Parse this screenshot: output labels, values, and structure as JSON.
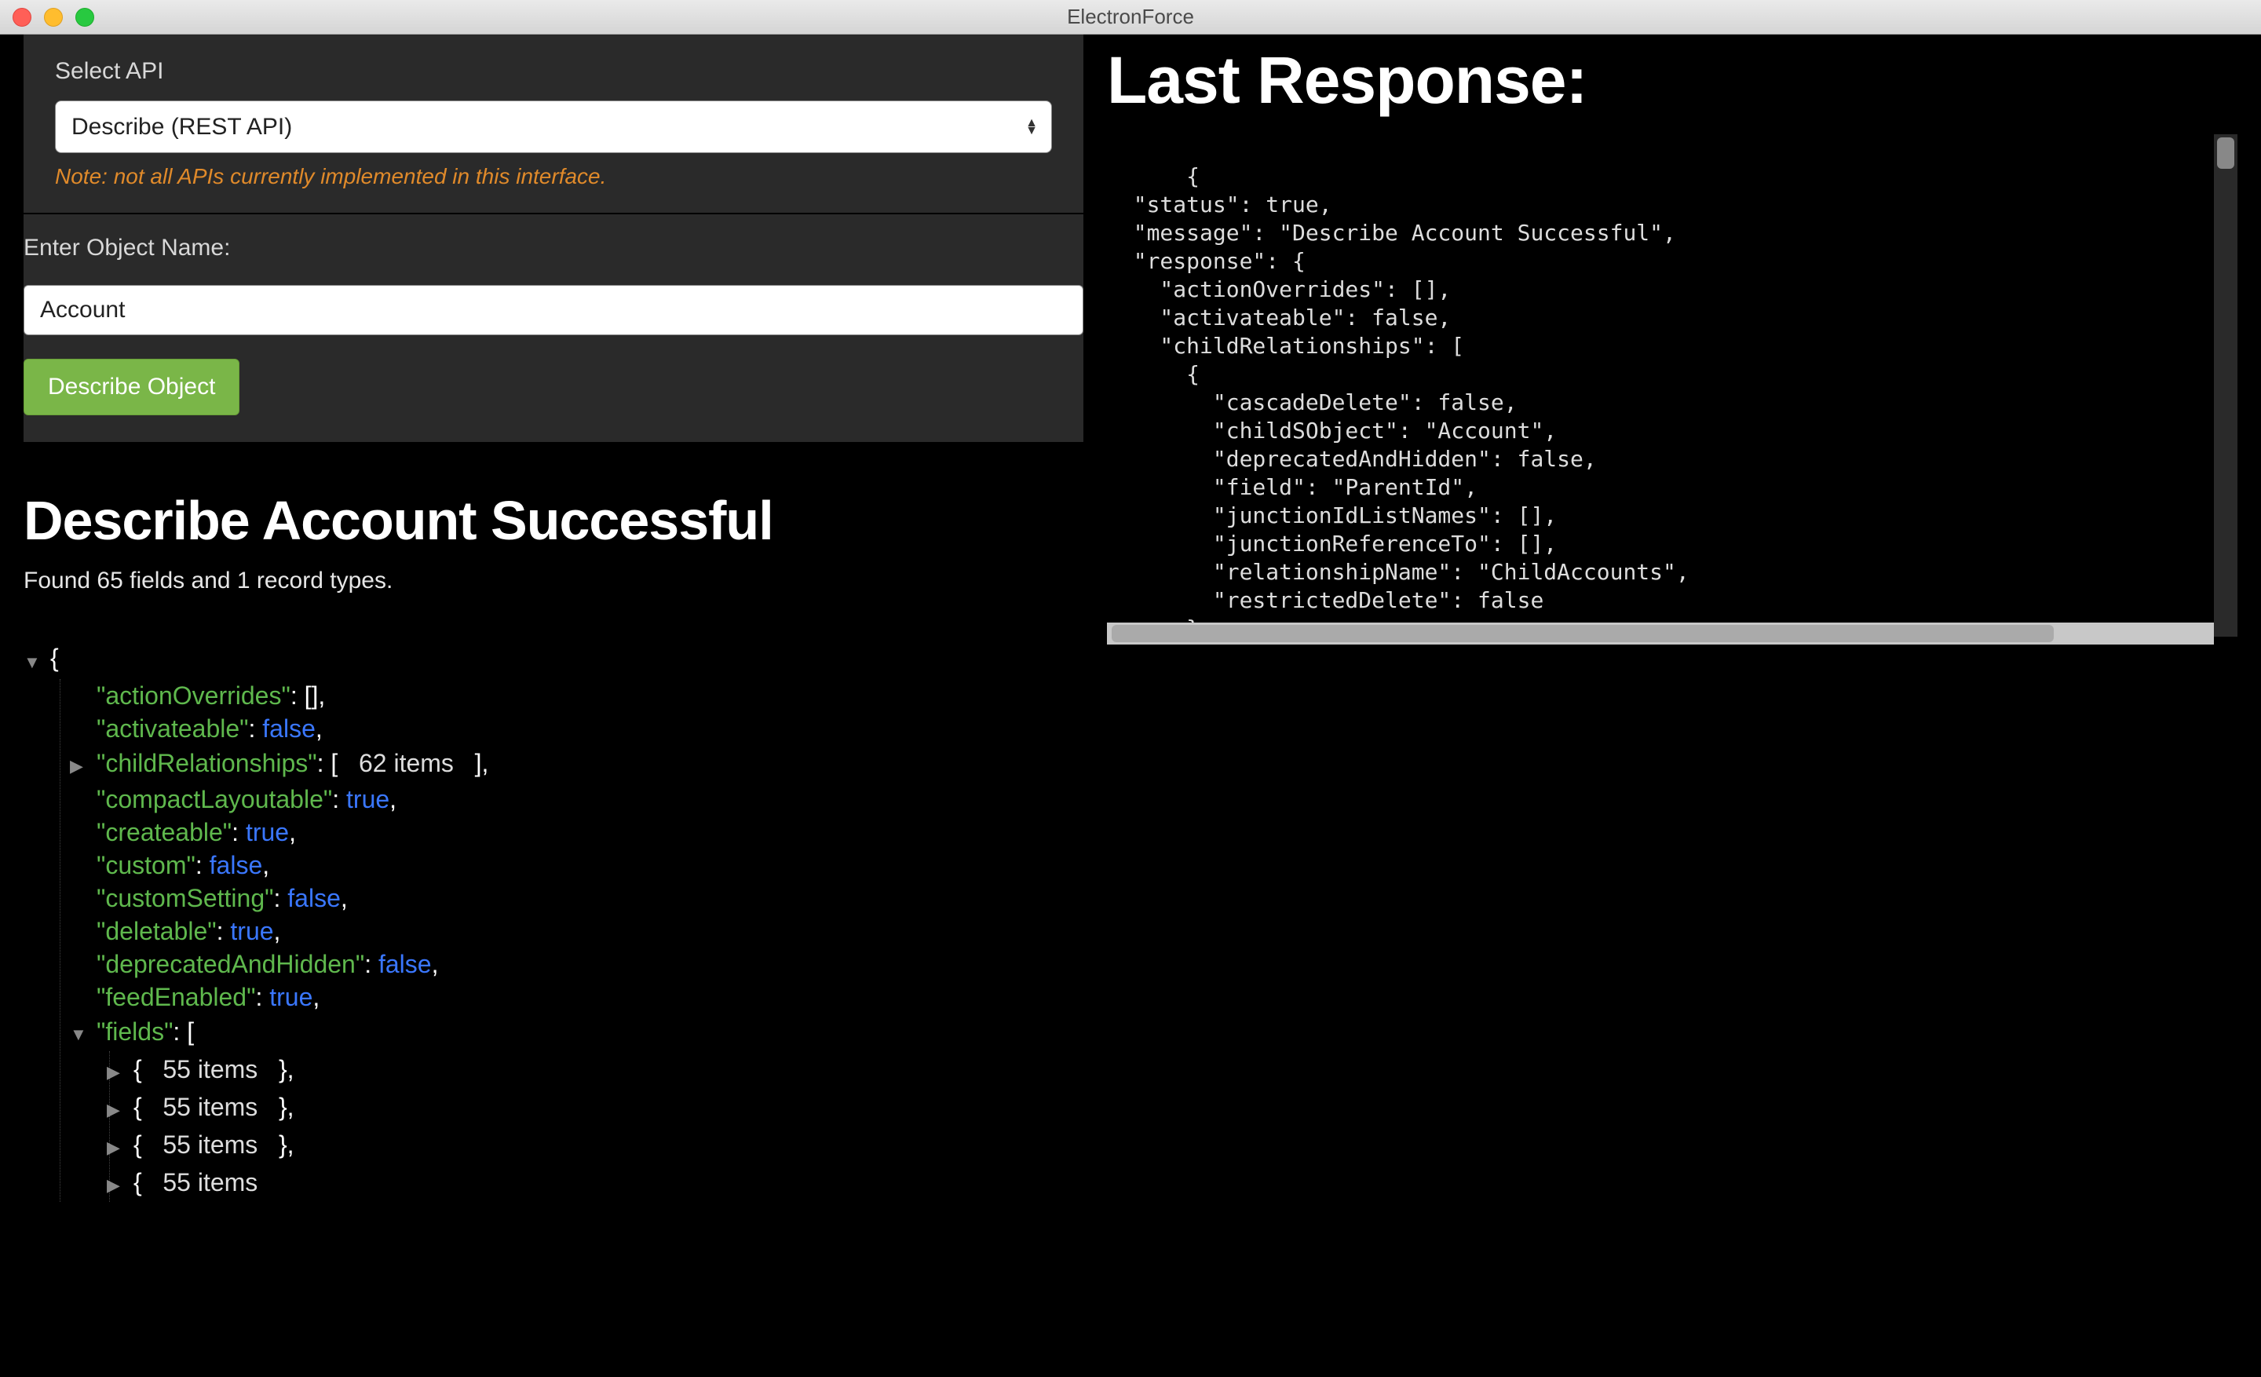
{
  "titlebar": {
    "title": "ElectronForce"
  },
  "form": {
    "select_label": "Select API",
    "select_value": "Describe (REST API)",
    "note": "Note: not all APIs currently implemented in this interface.",
    "object_label": "Enter Object Name:",
    "object_value": "Account",
    "button_label": "Describe Object"
  },
  "right": {
    "title": "Last Response:",
    "json_raw": "{\n  \"status\": true,\n  \"message\": \"Describe Account Successful\",\n  \"response\": {\n    \"actionOverrides\": [],\n    \"activateable\": false,\n    \"childRelationships\": [\n      {\n        \"cascadeDelete\": false,\n        \"childSObject\": \"Account\",\n        \"deprecatedAndHidden\": false,\n        \"field\": \"ParentId\",\n        \"junctionIdListNames\": [],\n        \"junctionReferenceTo\": [],\n        \"relationshipName\": \"ChildAccounts\",\n        \"restrictedDelete\": false\n      },\n      {"
  },
  "result": {
    "title": "Describe Account Successful",
    "summary": "Found 65 fields and 1 record types."
  },
  "tree": {
    "root_open": "{",
    "entries": [
      {
        "key": "\"actionOverrides\"",
        "value": "[]",
        "type": "punc"
      },
      {
        "key": "\"activateable\"",
        "value": "false",
        "type": "bool"
      },
      {
        "key": "\"childRelationships\"",
        "value_prefix": "[",
        "count": "62 items",
        "value_suffix": "]",
        "type": "collapsed"
      },
      {
        "key": "\"compactLayoutable\"",
        "value": "true",
        "type": "bool"
      },
      {
        "key": "\"createable\"",
        "value": "true",
        "type": "bool"
      },
      {
        "key": "\"custom\"",
        "value": "false",
        "type": "bool"
      },
      {
        "key": "\"customSetting\"",
        "value": "false",
        "type": "bool"
      },
      {
        "key": "\"deletable\"",
        "value": "true",
        "type": "bool"
      },
      {
        "key": "\"deprecatedAndHidden\"",
        "value": "false",
        "type": "bool"
      },
      {
        "key": "\"feedEnabled\"",
        "value": "true",
        "type": "bool"
      }
    ],
    "fields_key": "\"fields\"",
    "fields_open": "[",
    "field_items": [
      {
        "count": "55 items"
      },
      {
        "count": "55 items"
      },
      {
        "count": "55 items"
      },
      {
        "count": "55 items"
      }
    ]
  }
}
